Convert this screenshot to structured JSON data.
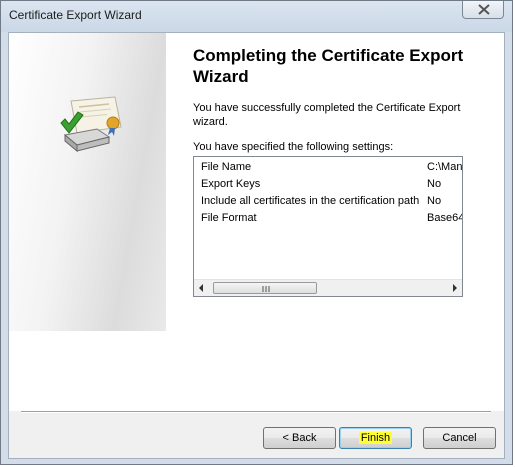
{
  "window": {
    "title": "Certificate Export Wizard"
  },
  "page": {
    "heading": "Completing the Certificate Export Wizard",
    "description": "You have successfully completed the Certificate Export wizard.",
    "settings_label": "You have specified the following settings:"
  },
  "settings": [
    {
      "name": "File Name",
      "value": "C:\\Man"
    },
    {
      "name": "Export Keys",
      "value": "No"
    },
    {
      "name": "Include all certificates in the certification path",
      "value": "No"
    },
    {
      "name": "File Format",
      "value": "Base64"
    }
  ],
  "buttons": {
    "back": "< Back",
    "finish": "Finish",
    "cancel": "Cancel"
  },
  "icons": {
    "wizard_art": "certificate-export-icon",
    "close": "close-icon",
    "scroll_left": "arrow-left-icon",
    "scroll_right": "arrow-right-icon"
  },
  "colors": {
    "highlight": "#ffff33",
    "check_green": "#3aa02f"
  }
}
